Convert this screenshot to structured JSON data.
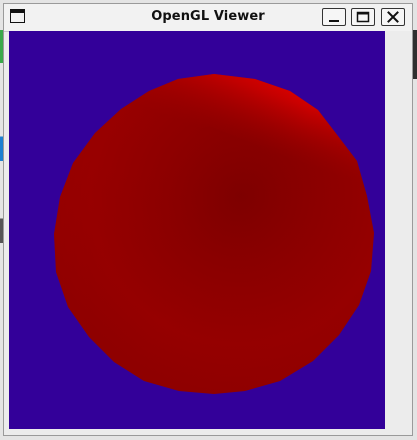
{
  "window": {
    "title": "OpenGL Viewer",
    "controls": {
      "minimize": "minimize",
      "maximize": "maximize",
      "close": "close"
    }
  },
  "viewport": {
    "clear_color": "#330099",
    "object": "sphere",
    "object_color": "#cc0000"
  }
}
